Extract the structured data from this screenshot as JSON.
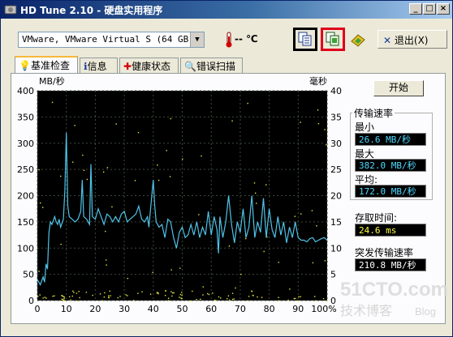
{
  "window": {
    "title": "HD Tune 2.10 - 硬盘实用程序"
  },
  "titlebar_buttons": {
    "minimize": "_",
    "maximize": "□",
    "close": "×"
  },
  "toolbar": {
    "drive": "VMware, VMware Virtual S (64 GB)",
    "temperature": "-- ℃",
    "exit_label": "退出(X)",
    "icons": [
      "copy-text-icon",
      "copy-image-icon",
      "save-icon"
    ]
  },
  "tabs": [
    {
      "label": "基准检查",
      "icon": "lightbulb-icon"
    },
    {
      "label": "信息",
      "icon": "info-icon"
    },
    {
      "label": "健康状态",
      "icon": "cross-icon"
    },
    {
      "label": "错误扫描",
      "icon": "magnifier-icon"
    }
  ],
  "benchmark": {
    "start_label": "开始",
    "transfer_rate_title": "传输速率",
    "min_label": "最小",
    "min_value": "26.6 MB/秒",
    "max_label": "最大",
    "max_value": "382.0 MB/秒",
    "avg_label": "平均:",
    "avg_value": "172.0 MB/秒",
    "access_time_label": "存取时间:",
    "access_time_value": "24.6 ms",
    "burst_label": "突发传输速率",
    "burst_value": "210.8 MB/秒"
  },
  "chart_data": {
    "type": "line",
    "ylabel_left": "MB/秒",
    "ylabel_right": "毫秒",
    "x_ticks": [
      "0",
      "10",
      "20",
      "30",
      "40",
      "50",
      "60",
      "70",
      "80",
      "90",
      "100%"
    ],
    "y_left_ticks": [
      "0",
      "50",
      "100",
      "150",
      "200",
      "250",
      "300",
      "350",
      "400"
    ],
    "y_right_ticks": [
      "0",
      "5",
      "10",
      "15",
      "20",
      "25",
      "30",
      "35",
      "40"
    ],
    "xlim": [
      0,
      100
    ],
    "ylim_left": [
      0,
      400
    ],
    "ylim_right": [
      0,
      40
    ],
    "grid": true,
    "colors": {
      "background": "#000000",
      "grid": "#3a4a3a",
      "line": "#4fc3e8",
      "dots": "#e8e840"
    },
    "series": [
      {
        "values": [
          [
            0,
            40
          ],
          [
            1,
            30
          ],
          [
            2,
            45
          ],
          [
            2.5,
            35
          ],
          [
            3,
            70
          ],
          [
            3.5,
            60
          ],
          [
            4,
            130
          ],
          [
            4.5,
            150
          ],
          [
            5,
            145
          ],
          [
            6,
            160
          ],
          [
            6.5,
            150
          ],
          [
            7,
            145
          ],
          [
            7.5,
            155
          ],
          [
            8,
            140
          ],
          [
            9,
            155
          ],
          [
            9.5,
            210
          ],
          [
            10,
            320
          ],
          [
            10.5,
            180
          ],
          [
            11,
            160
          ],
          [
            12,
            155
          ],
          [
            13,
            150
          ],
          [
            14,
            155
          ],
          [
            15,
            170
          ],
          [
            15.5,
            230
          ],
          [
            16,
            160
          ],
          [
            17,
            155
          ],
          [
            18,
            145
          ],
          [
            18.5,
            260
          ],
          [
            19,
            160
          ],
          [
            20,
            155
          ],
          [
            21,
            175
          ],
          [
            22,
            160
          ],
          [
            23,
            145
          ],
          [
            24,
            165
          ],
          [
            25,
            160
          ],
          [
            26,
            150
          ],
          [
            27,
            160
          ],
          [
            28,
            150
          ],
          [
            29,
            165
          ],
          [
            30,
            170
          ],
          [
            31,
            150
          ],
          [
            32,
            155
          ],
          [
            33,
            160
          ],
          [
            34,
            165
          ],
          [
            35,
            180
          ],
          [
            36,
            155
          ],
          [
            37,
            150
          ],
          [
            38,
            160
          ],
          [
            38.5,
            140
          ],
          [
            39,
            170
          ],
          [
            40,
            230
          ],
          [
            40.5,
            180
          ],
          [
            41,
            150
          ],
          [
            42,
            140
          ],
          [
            43,
            145
          ],
          [
            44,
            120
          ],
          [
            45,
            155
          ],
          [
            46,
            150
          ],
          [
            47,
            120
          ],
          [
            48,
            100
          ],
          [
            49,
            130
          ],
          [
            50,
            140
          ],
          [
            51,
            120
          ],
          [
            52,
            125
          ],
          [
            53,
            145
          ],
          [
            54,
            125
          ],
          [
            55,
            150
          ],
          [
            56,
            120
          ],
          [
            57,
            140
          ],
          [
            58,
            125
          ],
          [
            59,
            170
          ],
          [
            60,
            125
          ],
          [
            61,
            160
          ],
          [
            62,
            135
          ],
          [
            62.5,
            90
          ],
          [
            63,
            160
          ],
          [
            64,
            120
          ],
          [
            65,
            150
          ],
          [
            66,
            200
          ],
          [
            67,
            145
          ],
          [
            68,
            110
          ],
          [
            69,
            150
          ],
          [
            70,
            130
          ],
          [
            71,
            175
          ],
          [
            72,
            120
          ],
          [
            73,
            140
          ],
          [
            74,
            200
          ],
          [
            75,
            120
          ],
          [
            76,
            150
          ],
          [
            77,
            130
          ],
          [
            78,
            195
          ],
          [
            79,
            120
          ],
          [
            80,
            175
          ],
          [
            81,
            135
          ],
          [
            82,
            120
          ],
          [
            83,
            160
          ],
          [
            84,
            125
          ],
          [
            85,
            150
          ],
          [
            86,
            110
          ],
          [
            87,
            140
          ],
          [
            88,
            120
          ],
          [
            89,
            150
          ],
          [
            90,
            120
          ],
          [
            91,
            115
          ],
          [
            92,
            115
          ],
          [
            93,
            112
          ],
          [
            94,
            118
          ],
          [
            95,
            120
          ],
          [
            96,
            112
          ],
          [
            97,
            115
          ],
          [
            98,
            118
          ],
          [
            99,
            120
          ],
          [
            100,
            115
          ]
        ]
      }
    ]
  }
}
